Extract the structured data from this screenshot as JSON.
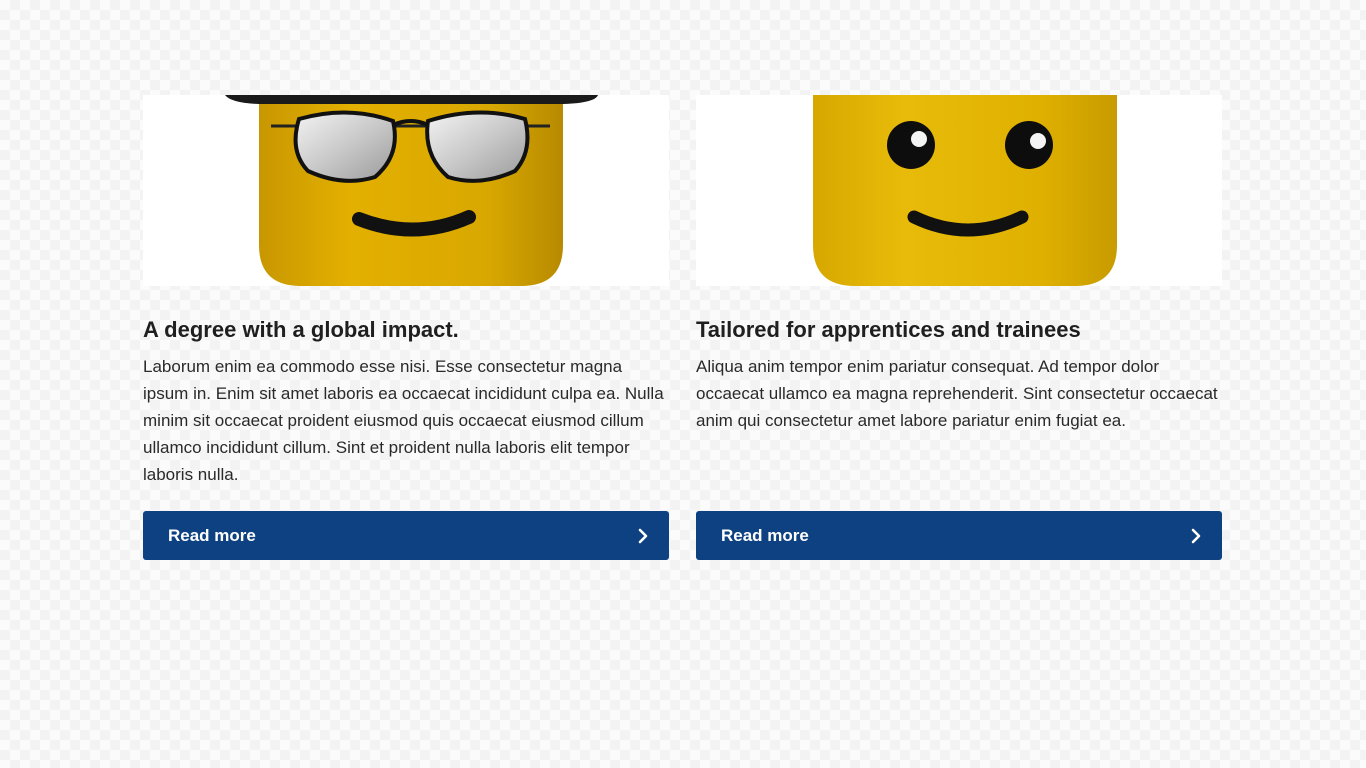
{
  "cards": [
    {
      "image_alt": "Minifigure head with sunglasses and hat",
      "title": "A degree with a global impact.",
      "text": "Laborum enim ea commodo esse nisi. Esse consectetur magna ipsum in. Enim sit amet laboris ea occaecat incididunt culpa ea. Nulla minim sit occaecat proident eiusmod quis occaecat eiusmod cillum ullamco incididunt cillum. Sint et proident nulla laboris elit tempor laboris nulla.",
      "button_label": "Read more",
      "button_icon": "chevron-right-icon"
    },
    {
      "image_alt": "Smiling yellow minifigure head",
      "title": "Tailored for apprentices and trainees",
      "text": "Aliqua anim tempor enim pariatur consequat. Ad tempor dolor occaecat ullamco ea magna reprehenderit. Sint consectetur occaecat anim qui consectetur amet labore pariatur enim fugiat ea.",
      "button_label": "Read more",
      "button_icon": "chevron-right-icon"
    }
  ],
  "colors": {
    "button_bg": "#0e4182",
    "button_text": "#ffffff",
    "figure_yellow": "#e0b000",
    "heading_text": "#1f1f1f"
  }
}
